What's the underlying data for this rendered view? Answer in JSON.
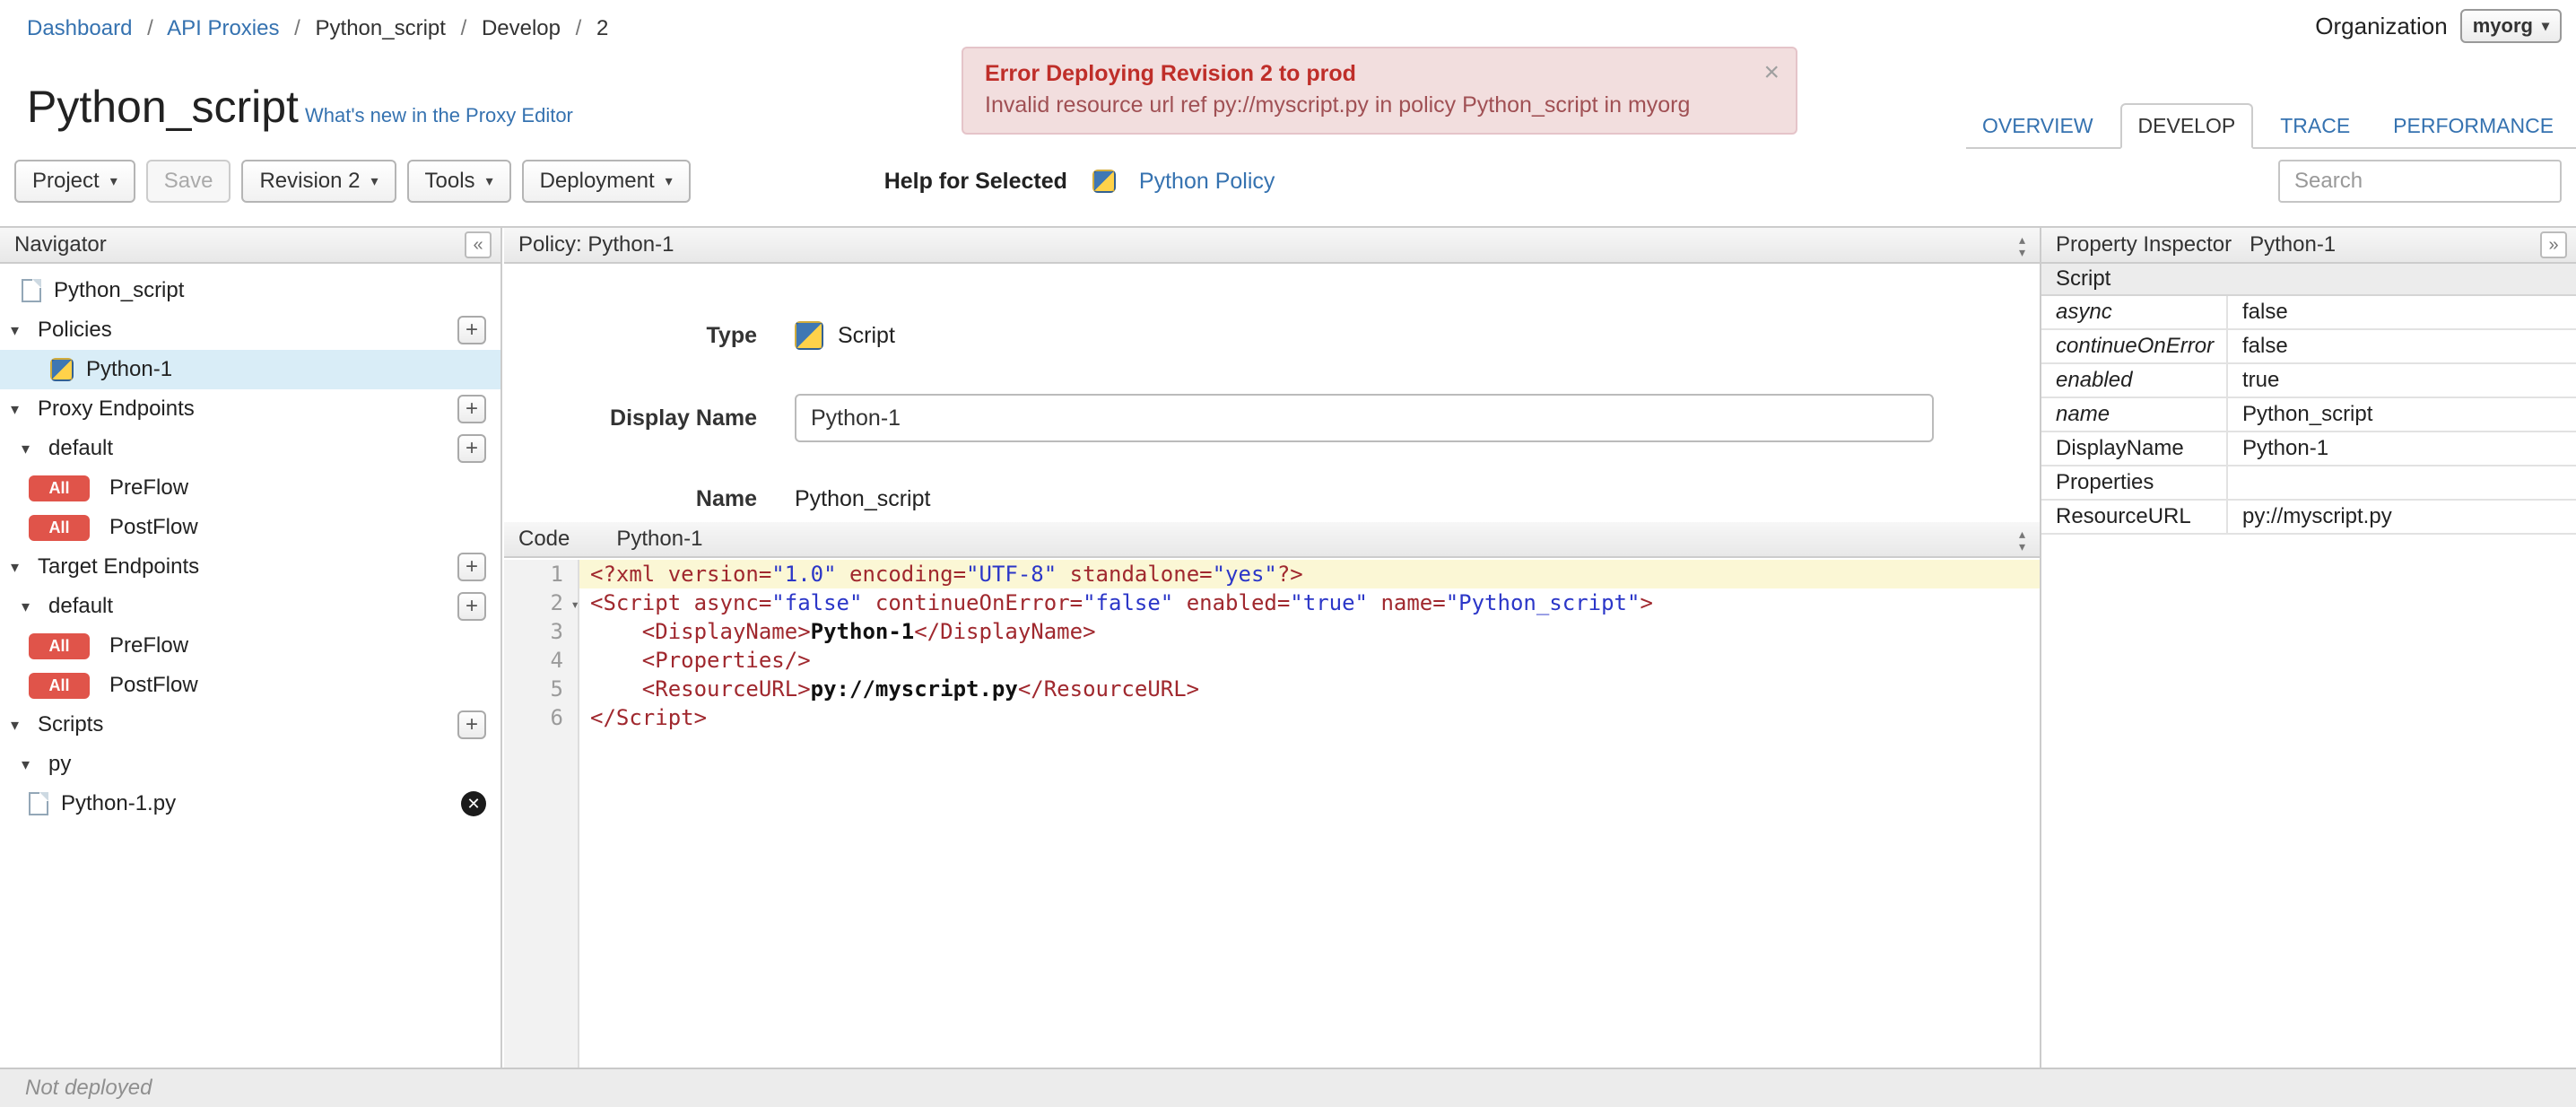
{
  "breadcrumb": {
    "sep": "/",
    "items": [
      {
        "label": "Dashboard",
        "link": true
      },
      {
        "label": "API Proxies",
        "link": true
      },
      {
        "label": "Python_script",
        "link": false
      },
      {
        "label": "Develop",
        "link": false
      },
      {
        "label": "2",
        "link": false
      }
    ]
  },
  "organization": {
    "label": "Organization",
    "value": "myorg"
  },
  "banner": {
    "title": "Error Deploying Revision 2 to prod",
    "message": "Invalid resource url ref py://myscript.py in policy Python_script in myorg"
  },
  "page": {
    "title": "Python_script",
    "whats_new": "What's new in the Proxy Editor"
  },
  "tabs": [
    {
      "label": "OVERVIEW",
      "active": false
    },
    {
      "label": "DEVELOP",
      "active": true
    },
    {
      "label": "TRACE",
      "active": false
    },
    {
      "label": "PERFORMANCE",
      "active": false
    }
  ],
  "toolbar": {
    "project": "Project",
    "save": "Save",
    "revision": "Revision 2",
    "tools": "Tools",
    "deployment": "Deployment",
    "help_label": "Help for Selected",
    "help_link": "Python Policy",
    "search_placeholder": "Search"
  },
  "navigator": {
    "title": "Navigator",
    "items": [
      {
        "label": "Python_script",
        "icon": "doc",
        "depth": 1
      },
      {
        "label": "Policies",
        "disclosure": true,
        "plus": true,
        "depth": 0
      },
      {
        "label": "Python-1",
        "icon": "policy",
        "selected": true,
        "depth": 3
      },
      {
        "label": "Proxy Endpoints",
        "disclosure": true,
        "plus": true,
        "depth": 0
      },
      {
        "label": "default",
        "disclosure": true,
        "plus": true,
        "depth": 1
      },
      {
        "label": "PreFlow",
        "badge": "All",
        "depth": 2
      },
      {
        "label": "PostFlow",
        "badge": "All",
        "depth": 2
      },
      {
        "label": "Target Endpoints",
        "disclosure": true,
        "plus": true,
        "depth": 0
      },
      {
        "label": "default",
        "disclosure": true,
        "plus": true,
        "depth": 1
      },
      {
        "label": "PreFlow",
        "badge": "All",
        "depth": 2
      },
      {
        "label": "PostFlow",
        "badge": "All",
        "depth": 2
      },
      {
        "label": "Scripts",
        "disclosure": true,
        "plus": true,
        "depth": 0
      },
      {
        "label": "py",
        "disclosure": true,
        "depth": 1
      },
      {
        "label": "Python-1.py",
        "icon": "doc",
        "del": true,
        "depth": 2
      }
    ]
  },
  "policy_panel": {
    "title": "Policy: Python-1",
    "type_label": "Type",
    "type_value": "Script",
    "display_name_label": "Display Name",
    "display_name_value": "Python-1",
    "name_label": "Name",
    "name_value": "Python_script"
  },
  "code_panel": {
    "label": "Code",
    "policy": "Python-1",
    "lines": [
      {
        "n": 1,
        "current": true,
        "tokens": [
          [
            "tag",
            "<?xml "
          ],
          [
            "attr",
            "version="
          ],
          [
            "str",
            "\"1.0\""
          ],
          [
            "attr",
            " encoding="
          ],
          [
            "str",
            "\"UTF-8\""
          ],
          [
            "attr",
            " standalone="
          ],
          [
            "str",
            "\"yes\""
          ],
          [
            "tag",
            "?>"
          ]
        ]
      },
      {
        "n": 2,
        "fold": true,
        "tokens": [
          [
            "tag",
            "<Script "
          ],
          [
            "attr",
            "async="
          ],
          [
            "str",
            "\"false\""
          ],
          [
            "attr",
            " continueOnError="
          ],
          [
            "str",
            "\"false\""
          ],
          [
            "attr",
            " enabled="
          ],
          [
            "str",
            "\"true\""
          ],
          [
            "attr",
            " name="
          ],
          [
            "str",
            "\"Python_script\""
          ],
          [
            "tag",
            ">"
          ]
        ]
      },
      {
        "n": 3,
        "tokens": [
          [
            "pl",
            "    "
          ],
          [
            "tag",
            "<DisplayName>"
          ],
          [
            "txt",
            "Python-1"
          ],
          [
            "tag",
            "</DisplayName>"
          ]
        ]
      },
      {
        "n": 4,
        "tokens": [
          [
            "pl",
            "    "
          ],
          [
            "tag",
            "<Properties/>"
          ]
        ]
      },
      {
        "n": 5,
        "tokens": [
          [
            "pl",
            "    "
          ],
          [
            "tag",
            "<ResourceURL>"
          ],
          [
            "txt",
            "py://myscript.py"
          ],
          [
            "tag",
            "</ResourceURL>"
          ]
        ]
      },
      {
        "n": 6,
        "tokens": [
          [
            "tag",
            "</Script>"
          ]
        ]
      }
    ]
  },
  "inspector": {
    "title": "Property Inspector",
    "policy": "Python-1",
    "section": "Script",
    "rows": [
      {
        "key": "async",
        "value": "false",
        "italic": true
      },
      {
        "key": "continueOnError",
        "value": "false",
        "italic": true
      },
      {
        "key": "enabled",
        "value": "true",
        "italic": true
      },
      {
        "key": "name",
        "value": "Python_script",
        "italic": true
      },
      {
        "key": "DisplayName",
        "value": "Python-1",
        "italic": false
      },
      {
        "key": "Properties",
        "value": "",
        "italic": false
      },
      {
        "key": "ResourceURL",
        "value": "py://myscript.py",
        "italic": false
      }
    ]
  },
  "statusbar": {
    "text": "Not deployed"
  }
}
